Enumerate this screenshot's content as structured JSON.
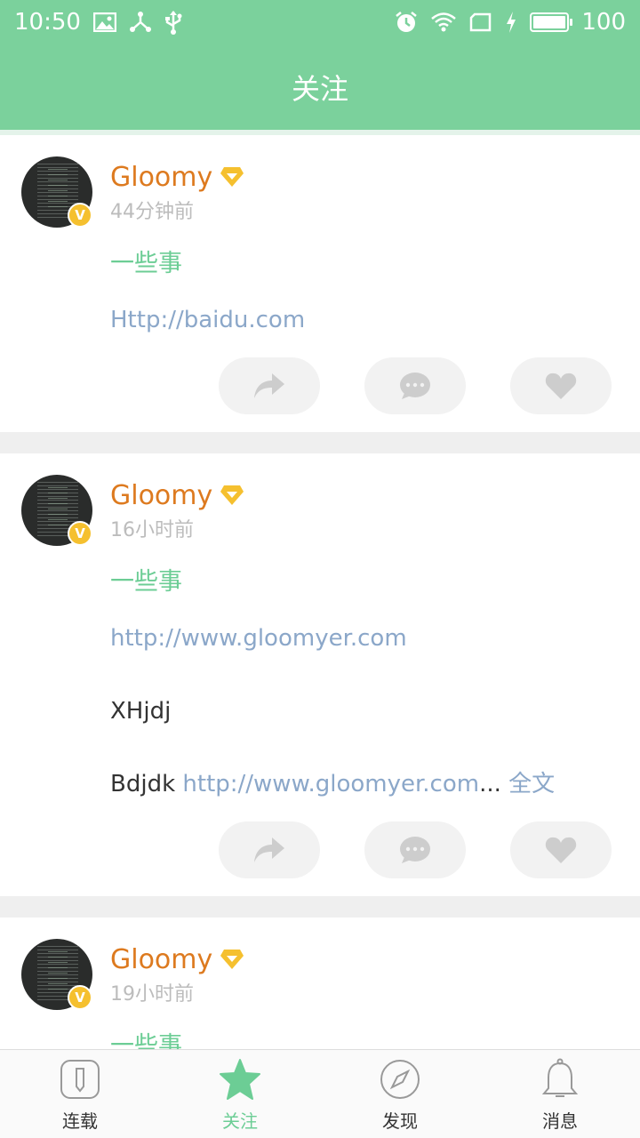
{
  "status_bar": {
    "time": "10:50",
    "battery": "100",
    "battery_level": 1.0,
    "icons": [
      "image-icon",
      "share-node-icon",
      "usb-icon",
      "alarm-icon",
      "wifi-icon",
      "sim-icon",
      "charging-icon",
      "battery-icon"
    ]
  },
  "header": {
    "title": "关注"
  },
  "colors": {
    "accent": "#7bd19c",
    "username": "#dd7a1f",
    "link": "#8ba7c9",
    "title_green": "#6ccd95"
  },
  "feed": [
    {
      "username": "Gloomy",
      "time": "44分钟前",
      "title": "一些事",
      "link": "Http://baidu.com"
    },
    {
      "username": "Gloomy",
      "time": "16小时前",
      "title": "一些事",
      "link": "http://www.gloomyer.com",
      "text1": "XHjdj",
      "text2_prefix": "Bdjdk ",
      "text2_link": "http://www.gloomyer.com",
      "text2_suffix": "... ",
      "full_text": "全文"
    },
    {
      "username": "Gloomy",
      "time": "19小时前",
      "title": "一些事"
    }
  ],
  "avatar_badge": "V",
  "bottom_nav": [
    {
      "label": "连载",
      "icon": "serial-icon",
      "active": false
    },
    {
      "label": "关注",
      "icon": "star-icon",
      "active": true
    },
    {
      "label": "发现",
      "icon": "compass-icon",
      "active": false
    },
    {
      "label": "消息",
      "icon": "bell-icon",
      "active": false
    }
  ]
}
